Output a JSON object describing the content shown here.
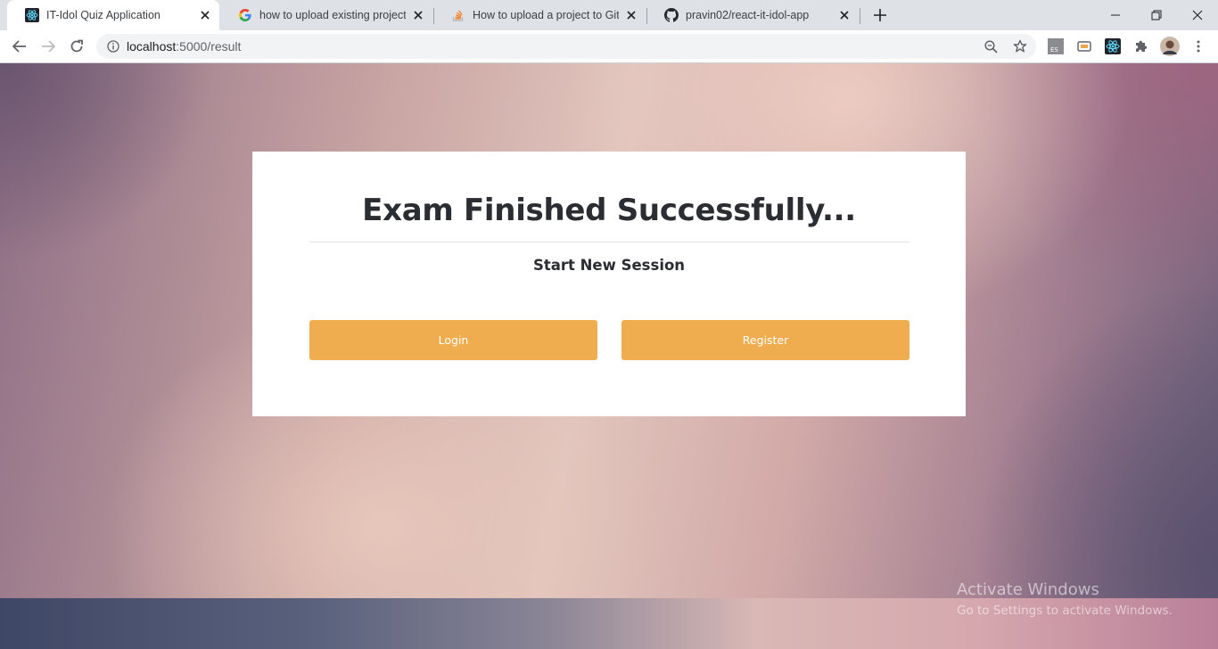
{
  "browser": {
    "tabs": [
      {
        "title": "IT-Idol Quiz Application",
        "favicon": "react-icon",
        "active": true
      },
      {
        "title": "how to upload existing project o",
        "favicon": "google-icon",
        "active": false
      },
      {
        "title": "How to upload a project to Githu",
        "favicon": "stackoverflow-icon",
        "active": false
      },
      {
        "title": "pravin02/react-it-idol-app",
        "favicon": "github-icon",
        "active": false
      }
    ],
    "url": {
      "host": "localhost",
      "path": ":5000/result"
    },
    "extensions": [
      "es-extension-icon",
      "cast-icon",
      "react-devtools-icon",
      "puzzle-icon",
      "avatar"
    ]
  },
  "card": {
    "title": "Exam Finished Successfully...",
    "subtitle": "Start New Session",
    "login_label": "Login",
    "register_label": "Register"
  },
  "watermark": {
    "line1": "Activate Windows",
    "line2": "Go to Settings to activate Windows."
  },
  "colors": {
    "accent": "#efad4f",
    "card_bg": "#ffffff",
    "text": "#2a2d31"
  }
}
